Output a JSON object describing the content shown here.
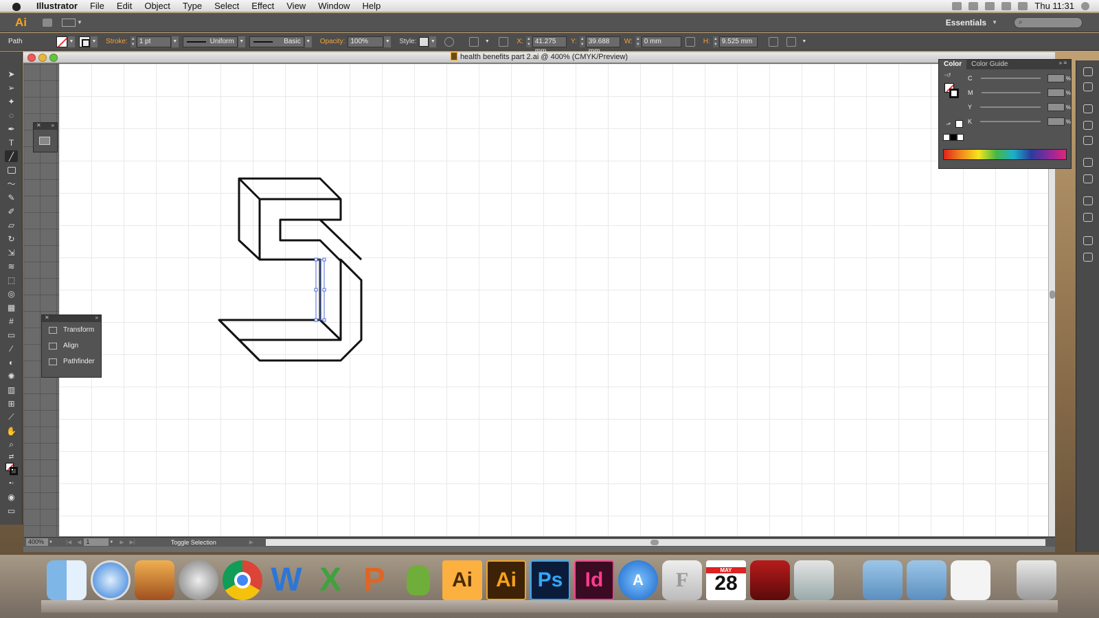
{
  "menubar": {
    "app_name": "Illustrator",
    "items": [
      "File",
      "Edit",
      "Object",
      "Type",
      "Select",
      "Effect",
      "View",
      "Window",
      "Help"
    ],
    "clock": "Thu 11:31",
    "status_icons": [
      "printer-icon",
      "time-machine-icon",
      "bluetooth-icon",
      "wifi-icon",
      "volume-icon"
    ]
  },
  "appbar": {
    "logo": "Ai",
    "workspace": "Essentials",
    "search_placeholder": ""
  },
  "controlbar": {
    "selection_type": "Path",
    "stroke_label": "Stroke:",
    "stroke_weight": "1 pt",
    "variable_width": "Uniform",
    "brush": "Basic",
    "opacity_label": "Opacity:",
    "opacity": "100%",
    "style_label": "Style:",
    "x_label": "X:",
    "x": "41.275 mm",
    "y_label": "Y:",
    "y": "39.688 mm",
    "w_label": "W:",
    "w": "0 mm",
    "h_label": "H:",
    "h": "9.525 mm"
  },
  "document": {
    "title": "health benefits part 2.ai @ 400% (CMYK/Preview)",
    "zoom": "400%",
    "page": "1",
    "status": "Toggle Selection"
  },
  "tools_panel": {
    "items": [
      "Transform",
      "Align",
      "Pathfinder"
    ]
  },
  "color_panel": {
    "tabs": [
      "Color",
      "Color Guide"
    ],
    "channels": [
      {
        "label": "C",
        "value": ""
      },
      {
        "label": "M",
        "value": ""
      },
      {
        "label": "Y",
        "value": ""
      },
      {
        "label": "K",
        "value": ""
      }
    ],
    "percent": "%"
  },
  "dock": {
    "apps": [
      {
        "name": "finder",
        "label": ""
      },
      {
        "name": "safari",
        "label": ""
      },
      {
        "name": "iphoto",
        "label": ""
      },
      {
        "name": "system-preferences",
        "label": ""
      },
      {
        "name": "chrome",
        "label": ""
      },
      {
        "name": "word",
        "label": "W"
      },
      {
        "name": "excel",
        "label": "X"
      },
      {
        "name": "powerpoint",
        "label": "P"
      },
      {
        "name": "game",
        "label": ""
      },
      {
        "name": "illustrator-1",
        "label": "Ai"
      },
      {
        "name": "illustrator-2",
        "label": "Ai"
      },
      {
        "name": "photoshop",
        "label": "Ps"
      },
      {
        "name": "indesign",
        "label": "Id"
      },
      {
        "name": "app-store",
        "label": ""
      },
      {
        "name": "fontbook",
        "label": "F"
      },
      {
        "name": "calendar",
        "label": "28",
        "sub": "MAY"
      },
      {
        "name": "photo-booth",
        "label": ""
      },
      {
        "name": "preview",
        "label": ""
      },
      {
        "name": "applications-folder",
        "label": ""
      },
      {
        "name": "documents-folder",
        "label": ""
      },
      {
        "name": "downloads-stack",
        "label": ""
      },
      {
        "name": "trash",
        "label": ""
      }
    ]
  },
  "colors": {
    "accent": "#f7a21b",
    "selection": "#4a6cd4",
    "stroke": "#111111"
  }
}
